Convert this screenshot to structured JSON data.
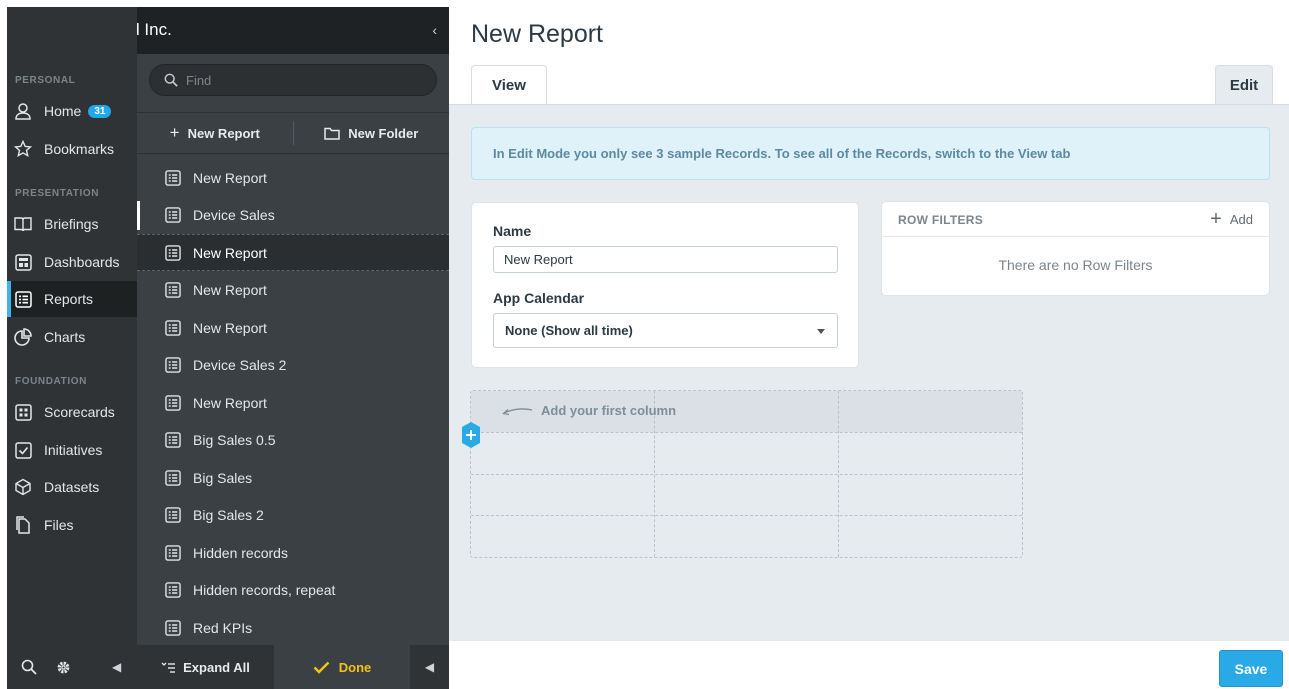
{
  "org": {
    "name": "Mobileworld Inc.",
    "collapse_icon": "chevron-left-icon"
  },
  "nav": {
    "personal_label": "PERSONAL",
    "presentation_label": "PRESENTATION",
    "foundation_label": "FOUNDATION",
    "items": [
      {
        "label": "Home",
        "icon": "user-icon",
        "badge": "31"
      },
      {
        "label": "Bookmarks",
        "icon": "star-icon"
      },
      {
        "label": "Briefings",
        "icon": "book-icon"
      },
      {
        "label": "Dashboards",
        "icon": "dashboard-icon"
      },
      {
        "label": "Reports",
        "icon": "report-icon",
        "active": true
      },
      {
        "label": "Charts",
        "icon": "pie-chart-icon"
      },
      {
        "label": "Scorecards",
        "icon": "scorecard-icon"
      },
      {
        "label": "Initiatives",
        "icon": "checkbox-icon"
      },
      {
        "label": "Datasets",
        "icon": "cube-icon"
      },
      {
        "label": "Files",
        "icon": "files-icon"
      }
    ]
  },
  "list": {
    "search_placeholder": "Find",
    "new_report_label": "New Report",
    "new_folder_label": "New Folder",
    "items": [
      "New Report",
      "Device Sales",
      "New Report",
      "New Report",
      "New Report",
      "Device Sales 2",
      "New Report",
      "Big Sales 0.5",
      "Big Sales",
      "Big Sales 2",
      "Hidden records",
      "Hidden records, repeat",
      "Red KPIs"
    ],
    "expand_all_label": "Expand All",
    "done_label": "Done"
  },
  "page": {
    "title": "New Report",
    "tabs": {
      "view": "View",
      "edit": "Edit"
    },
    "banner": "In Edit Mode you only see 3 sample Records. To see all of the Records, switch to the View tab",
    "name_label": "Name",
    "name_value": "New Report",
    "calendar_label": "App Calendar",
    "calendar_value": "None (Show all time)",
    "row_filters_title": "ROW FILTERS",
    "row_filters_add": "Add",
    "row_filters_empty": "There are no Row Filters",
    "column_hint": "Add your first column",
    "save_label": "Save"
  },
  "colors": {
    "accent": "#29a9e6",
    "done": "#f3c318",
    "nav_bg": "#2f3336",
    "list_bg": "#3b4044"
  }
}
